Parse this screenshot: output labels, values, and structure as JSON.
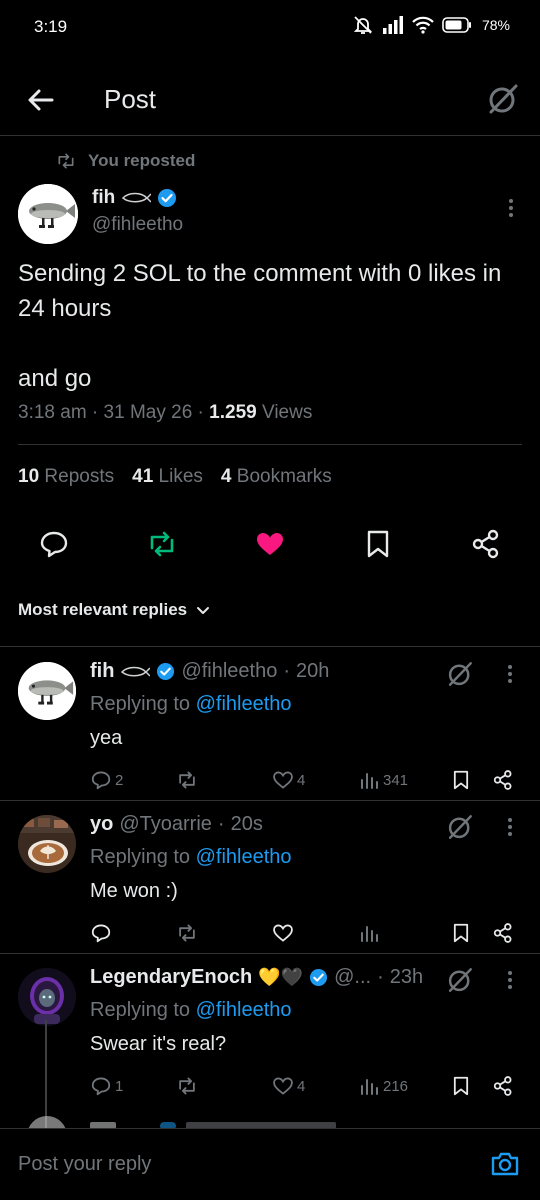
{
  "status_bar": {
    "time": "3:19",
    "battery": "78%"
  },
  "header": {
    "title": "Post"
  },
  "post": {
    "repost_context": "You reposted",
    "author": {
      "name": "fih",
      "handle": "@fihleetho"
    },
    "text_lines": [
      "Sending 2 SOL to the comment with 0 likes in 24 hours",
      "and go"
    ],
    "time": "3:18 am",
    "date": "31 May 26",
    "views_count": "1.259",
    "views_label": "Views",
    "stats": {
      "reposts_count": "10",
      "reposts_label": "Reposts",
      "likes_count": "41",
      "likes_label": "Likes",
      "bookmarks_count": "4",
      "bookmarks_label": "Bookmarks"
    }
  },
  "replies_sort": {
    "label": "Most relevant replies"
  },
  "replies": [
    {
      "name": "fih",
      "handle": "@fihleetho",
      "time": "20h",
      "replying_prefix": "Replying to",
      "replying_to": "@fihleetho",
      "text": "yea",
      "comments": "2",
      "reposts": "",
      "likes": "4",
      "views": "341"
    },
    {
      "name": "yo",
      "handle": "@Tyoarrie",
      "time": "20s",
      "replying_prefix": "Replying to",
      "replying_to": "@fihleetho",
      "text": "Me won :)",
      "comments": "",
      "reposts": "",
      "likes": "",
      "views": ""
    },
    {
      "name": "LegendaryEnoch",
      "emoji": "💛🖤",
      "handle": "@...",
      "time": "23h",
      "replying_prefix": "Replying to",
      "replying_to": "@fihleetho",
      "text": "Swear it's real?",
      "comments": "1",
      "reposts": "",
      "likes": "4",
      "views": "216"
    }
  ],
  "compose": {
    "placeholder": "Post your reply"
  },
  "colors": {
    "background": "#000000",
    "text": "#e7e9ea",
    "muted": "#71767b",
    "link": "#1d9bf0",
    "verified": "#1d9bf0",
    "repost_active": "#00ba7c",
    "like_active": "#f91880",
    "divider": "#2f3336"
  }
}
